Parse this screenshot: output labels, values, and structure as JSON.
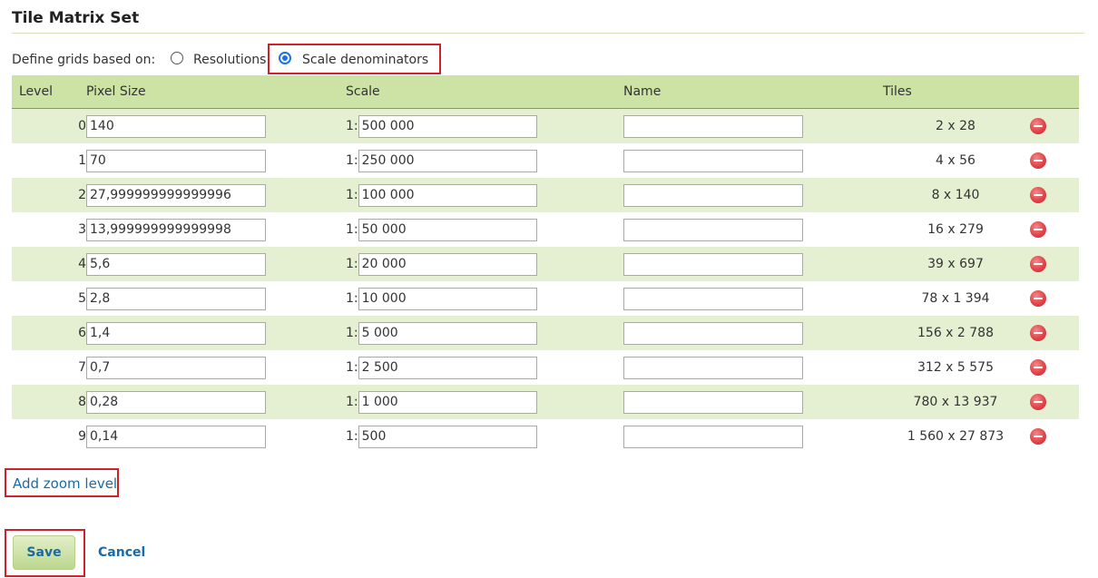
{
  "section": {
    "title": "Tile Matrix Set"
  },
  "define": {
    "label": "Define grids based on:",
    "options": [
      {
        "label": "Resolutions",
        "selected": false
      },
      {
        "label": "Scale denominators",
        "selected": true
      }
    ]
  },
  "table": {
    "headers": {
      "level": "Level",
      "pixel_size": "Pixel Size",
      "scale": "Scale",
      "name": "Name",
      "tiles": "Tiles"
    },
    "scale_prefix": "1:",
    "rows": [
      {
        "level": "0",
        "pixel_size": "140",
        "scale": "500 000",
        "name": "",
        "tiles": "2 x 28"
      },
      {
        "level": "1",
        "pixel_size": "70",
        "scale": "250 000",
        "name": "",
        "tiles": "4 x 56"
      },
      {
        "level": "2",
        "pixel_size": "27,999999999999996",
        "scale": "100 000",
        "name": "",
        "tiles": "8 x 140"
      },
      {
        "level": "3",
        "pixel_size": "13,999999999999998",
        "scale": "50 000",
        "name": "",
        "tiles": "16 x 279"
      },
      {
        "level": "4",
        "pixel_size": "5,6",
        "scale": "20 000",
        "name": "",
        "tiles": "39 x 697"
      },
      {
        "level": "5",
        "pixel_size": "2,8",
        "scale": "10 000",
        "name": "",
        "tiles": "78 x 1 394"
      },
      {
        "level": "6",
        "pixel_size": "1,4",
        "scale": "5 000",
        "name": "",
        "tiles": "156 x 2 788"
      },
      {
        "level": "7",
        "pixel_size": "0,7",
        "scale": "2 500",
        "name": "",
        "tiles": "312 x 5 575"
      },
      {
        "level": "8",
        "pixel_size": "0,28",
        "scale": "1 000",
        "name": "",
        "tiles": "780 x 13 937"
      },
      {
        "level": "9",
        "pixel_size": "0,14",
        "scale": "500",
        "name": "",
        "tiles": "1 560 x 27 873"
      }
    ]
  },
  "actions": {
    "add_zoom_level": "Add zoom level",
    "save": "Save",
    "cancel": "Cancel"
  },
  "colors": {
    "header_bg": "#cde3a6",
    "row_alt_bg": "#e5f0d2",
    "link": "#1c6aa3",
    "highlight": "#d0202a",
    "radio_accent": "#1a73e8",
    "delete_icon": "#e0444a"
  },
  "icons": {
    "delete": "remove-circle-icon"
  }
}
